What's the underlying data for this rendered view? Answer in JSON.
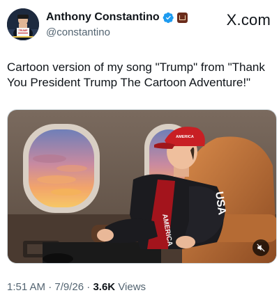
{
  "post": {
    "author_name": "Anthony Constantino",
    "handle": "@constantino",
    "brand": "X.com",
    "text": "Cartoon version of my song \"Trump\" from \"Thank You President Trump The Cartoon Adventure!\"",
    "time": "1:51 AM",
    "date": "7/9/26",
    "separator": "·",
    "views_count": "3.6K",
    "views_label": "Views"
  },
  "avatar": {
    "hat_text": "TRUMP"
  },
  "media": {
    "hat_text": "AMERICA",
    "jacket_text": "USA",
    "shirt_text": "AMERICA"
  },
  "colors": {
    "verified": "#1d9bf0",
    "text_primary": "#0f1419",
    "text_secondary": "#536471",
    "hat_red": "#c81f24"
  },
  "icons": [
    "verified-badge-icon",
    "affiliate-badge-icon",
    "mute-icon"
  ]
}
